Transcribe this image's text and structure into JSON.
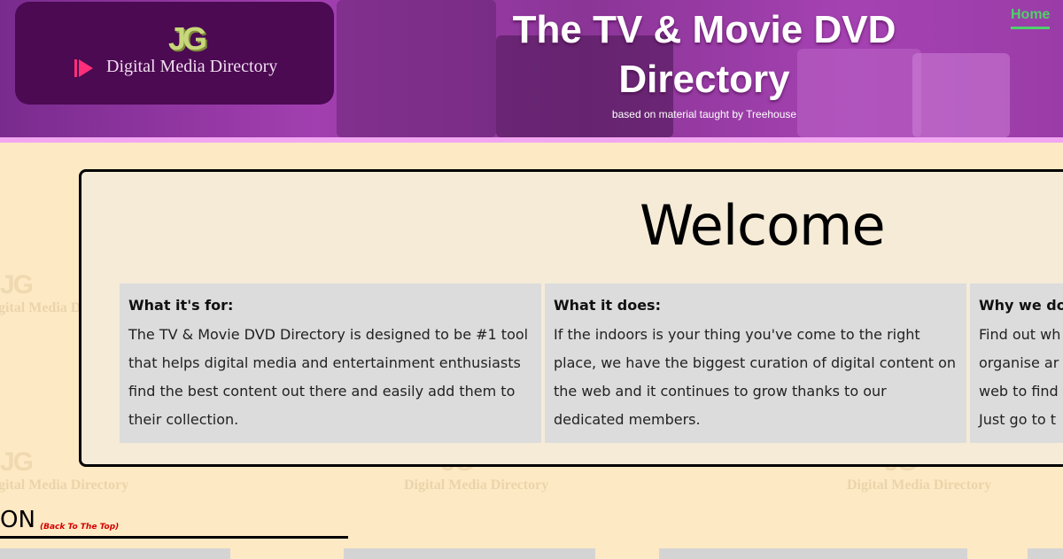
{
  "header": {
    "logo_mark": "JG",
    "logo_text": "Digital Media Directory",
    "title": "The TV & Movie DVD Directory",
    "subtitle": "based on material taught by Treehouse"
  },
  "nav": {
    "home_label": "Home"
  },
  "watermark": {
    "mark": "JG",
    "text": "Digital Media Directory"
  },
  "welcome": {
    "title": "Welcome",
    "columns": [
      {
        "heading": "What it's for:",
        "body": "The TV & Movie DVD Directory is designed to be #1 tool that helps digital media and entertainment enthusiasts find the best content out there and easily add them to their collection."
      },
      {
        "heading": "What it does:",
        "body": "If the indoors is your thing you've come to the right place, we have the biggest curation of digital content on the web and it continues to grow thanks to our dedicated members."
      },
      {
        "heading": "Why we do i",
        "body": "Find out wh organise ar web to find Just go to t"
      }
    ]
  },
  "section": {
    "heading": "ON",
    "back_to_top": "(Back To The Top)"
  },
  "colors": {
    "page_bg": "#fde9c4",
    "header_purple": "#9a3ca8",
    "logo_card": "#4b0a52",
    "nav_green": "#4fd16a",
    "panel_bg": "#f5ebd7",
    "column_bg": "#dcdcdc",
    "back_top_red": "#d40000"
  }
}
